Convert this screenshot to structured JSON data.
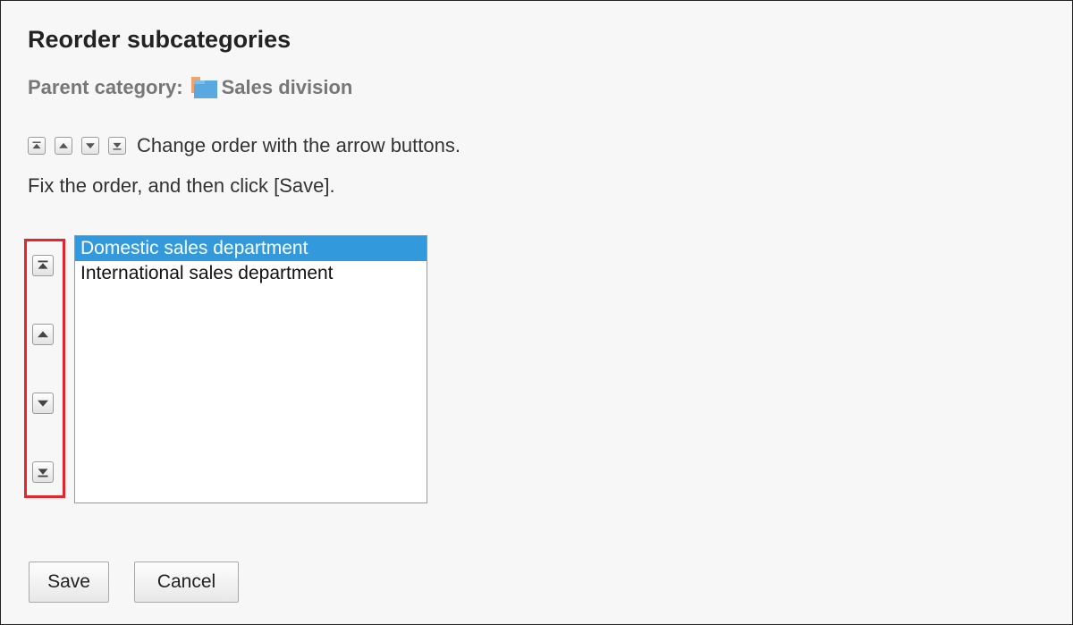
{
  "page": {
    "title": "Reorder subcategories",
    "parent_label": "Parent category:",
    "parent_name": "Sales division"
  },
  "instructions": {
    "line1": "Change order with the arrow buttons.",
    "line2": "Fix the order, and then click [Save]."
  },
  "icons": {
    "folder": "folder-icon",
    "move_top": "move-top-icon",
    "move_up": "move-up-icon",
    "move_down": "move-down-icon",
    "move_bottom": "move-bottom-icon"
  },
  "subcategories": {
    "items": [
      {
        "label": "Domestic sales department",
        "selected": true
      },
      {
        "label": "International sales department",
        "selected": false
      }
    ]
  },
  "actions": {
    "save_label": "Save",
    "cancel_label": "Cancel"
  },
  "colors": {
    "highlight": "#e8242b",
    "selection": "#3399dd",
    "folder": "#5aa8e0",
    "folder_tab": "#f0a36a"
  }
}
